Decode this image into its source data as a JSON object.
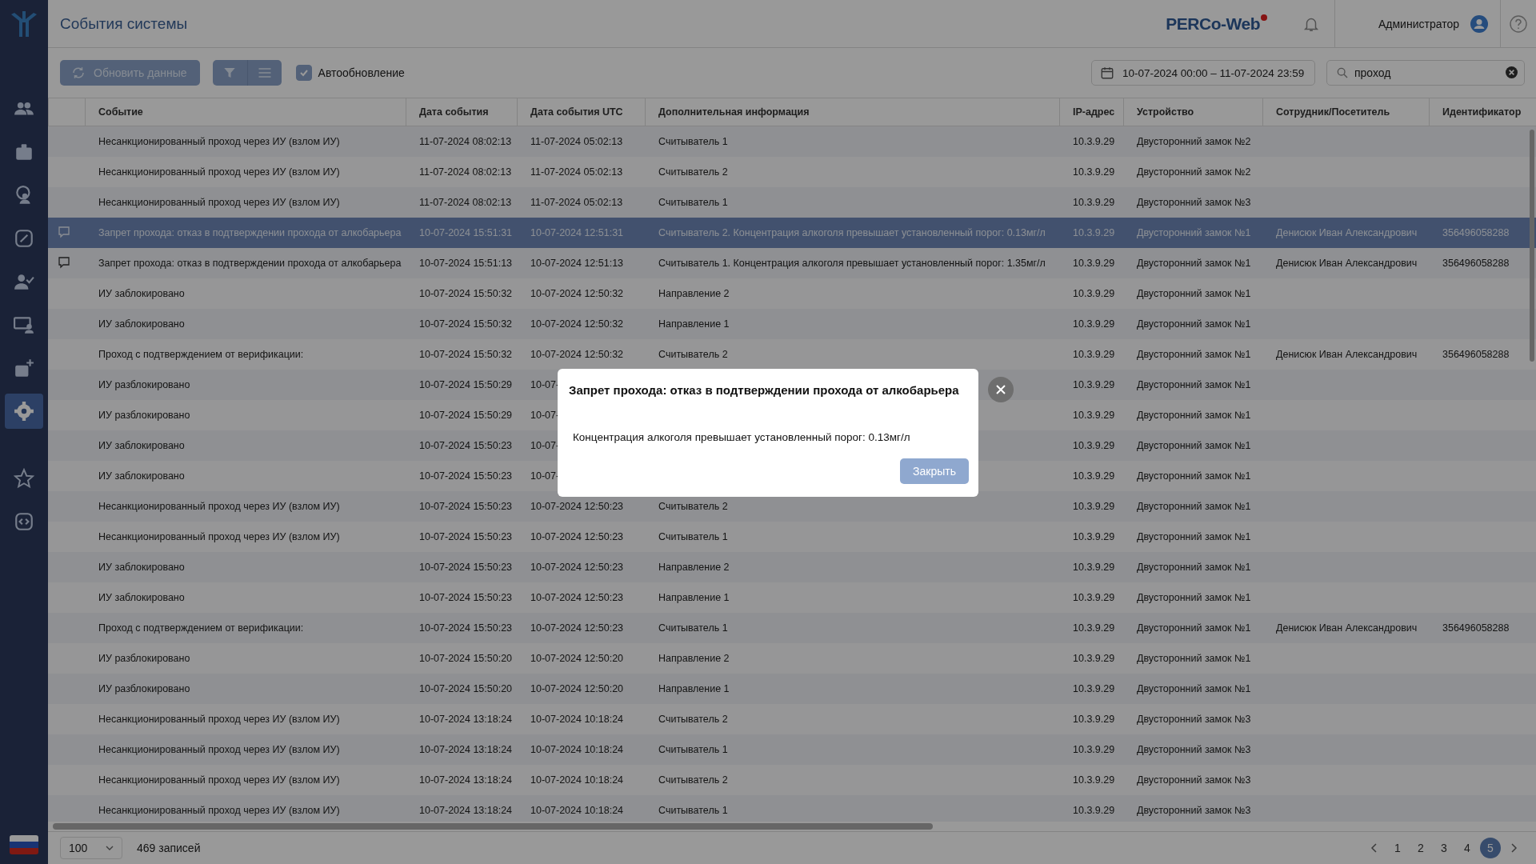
{
  "sidebar": {
    "items": [
      {
        "selected": false
      },
      {
        "selected": false
      },
      {
        "selected": false
      },
      {
        "selected": false
      },
      {
        "selected": false
      },
      {
        "selected": false
      },
      {
        "selected": false
      },
      {
        "selected": true
      },
      {
        "selected": false
      },
      {
        "selected": false
      }
    ]
  },
  "header": {
    "title": "События системы",
    "logo": "PERCo-Web",
    "user": "Администратор"
  },
  "toolbar": {
    "refresh": "Обновить данные",
    "autoupdate": {
      "label": "Автообновление",
      "checked": true
    },
    "date_range": "10-07-2024 00:00 – 11-07-2024 23:59",
    "search": {
      "value": "проход"
    }
  },
  "table": {
    "columns": [
      "Событие",
      "Дата события",
      "Дата события UTC",
      "Дополнительная информация",
      "IP-адрес",
      "Устройство",
      "Сотрудник/Посетитель",
      "Идентификатор"
    ],
    "rows": [
      {
        "selected": false,
        "comment": false,
        "cells": [
          "Несанкционированный проход через ИУ (взлом ИУ)",
          "11-07-2024 08:02:13",
          "11-07-2024 05:02:13",
          "Считыватель 1",
          "10.3.9.29",
          "Двусторонний замок №2",
          "",
          ""
        ]
      },
      {
        "selected": false,
        "comment": false,
        "cells": [
          "Несанкционированный проход через ИУ (взлом ИУ)",
          "11-07-2024 08:02:13",
          "11-07-2024 05:02:13",
          "Считыватель 2",
          "10.3.9.29",
          "Двусторонний замок №2",
          "",
          ""
        ]
      },
      {
        "selected": false,
        "comment": false,
        "cells": [
          "Несанкционированный проход через ИУ (взлом ИУ)",
          "11-07-2024 08:02:13",
          "11-07-2024 05:02:13",
          "Считыватель 1",
          "10.3.9.29",
          "Двусторонний замок №3",
          "",
          ""
        ]
      },
      {
        "selected": true,
        "comment": true,
        "cells": [
          "Запрет прохода: отказ в подтверждении прохода от алкобарьера",
          "10-07-2024 15:51:31",
          "10-07-2024 12:51:31",
          "Считыватель 2. Концентрация алкоголя превышает установленный порог: 0.13мг/л",
          "10.3.9.29",
          "Двусторонний замок №1",
          "Денисюк Иван Александрович",
          "356496058288"
        ]
      },
      {
        "selected": false,
        "comment": true,
        "cells": [
          "Запрет прохода: отказ в подтверждении прохода от алкобарьера",
          "10-07-2024 15:51:13",
          "10-07-2024 12:51:13",
          "Считыватель 1. Концентрация алкоголя превышает установленный порог: 1.35мг/л",
          "10.3.9.29",
          "Двусторонний замок №1",
          "Денисюк Иван Александрович",
          "356496058288"
        ]
      },
      {
        "selected": false,
        "comment": false,
        "cells": [
          "ИУ заблокировано",
          "10-07-2024 15:50:32",
          "10-07-2024 12:50:32",
          "Направление 2",
          "10.3.9.29",
          "Двусторонний замок №1",
          "",
          ""
        ]
      },
      {
        "selected": false,
        "comment": false,
        "cells": [
          "ИУ заблокировано",
          "10-07-2024 15:50:32",
          "10-07-2024 12:50:32",
          "Направление 1",
          "10.3.9.29",
          "Двусторонний замок №1",
          "",
          ""
        ]
      },
      {
        "selected": false,
        "comment": false,
        "cells": [
          "Проход с подтверждением от верификации:",
          "10-07-2024 15:50:32",
          "10-07-2024 12:50:32",
          "Считыватель 2",
          "10.3.9.29",
          "Двусторонний замок №1",
          "Денисюк Иван Александрович",
          "356496058288"
        ]
      },
      {
        "selected": false,
        "comment": false,
        "cells": [
          "ИУ разблокировано",
          "10-07-2024 15:50:29",
          "10-07-",
          "",
          "10.3.9.29",
          "Двусторонний замок №1",
          "",
          ""
        ]
      },
      {
        "selected": false,
        "comment": false,
        "cells": [
          "ИУ разблокировано",
          "10-07-2024 15:50:29",
          "10-07-",
          "",
          "10.3.9.29",
          "Двусторонний замок №1",
          "",
          ""
        ]
      },
      {
        "selected": false,
        "comment": false,
        "cells": [
          "ИУ заблокировано",
          "10-07-2024 15:50:23",
          "10-07-",
          "",
          "10.3.9.29",
          "Двусторонний замок №1",
          "",
          ""
        ]
      },
      {
        "selected": false,
        "comment": false,
        "cells": [
          "ИУ заблокировано",
          "10-07-2024 15:50:23",
          "10-07-",
          "",
          "10.3.9.29",
          "Двусторонний замок №1",
          "",
          ""
        ]
      },
      {
        "selected": false,
        "comment": false,
        "cells": [
          "Несанкционированный проход через ИУ (взлом ИУ)",
          "10-07-2024 15:50:23",
          "10-07-2024 12:50:23",
          "Считыватель 2",
          "10.3.9.29",
          "Двусторонний замок №1",
          "",
          ""
        ]
      },
      {
        "selected": false,
        "comment": false,
        "cells": [
          "Несанкционированный проход через ИУ (взлом ИУ)",
          "10-07-2024 15:50:23",
          "10-07-2024 12:50:23",
          "Считыватель 1",
          "10.3.9.29",
          "Двусторонний замок №1",
          "",
          ""
        ]
      },
      {
        "selected": false,
        "comment": false,
        "cells": [
          "ИУ заблокировано",
          "10-07-2024 15:50:23",
          "10-07-2024 12:50:23",
          "Направление 2",
          "10.3.9.29",
          "Двусторонний замок №1",
          "",
          ""
        ]
      },
      {
        "selected": false,
        "comment": false,
        "cells": [
          "ИУ заблокировано",
          "10-07-2024 15:50:23",
          "10-07-2024 12:50:23",
          "Направление 1",
          "10.3.9.29",
          "Двусторонний замок №1",
          "",
          ""
        ]
      },
      {
        "selected": false,
        "comment": false,
        "cells": [
          "Проход с подтверждением от верификации:",
          "10-07-2024 15:50:23",
          "10-07-2024 12:50:23",
          "Считыватель 1",
          "10.3.9.29",
          "Двусторонний замок №1",
          "Денисюк Иван Александрович",
          "356496058288"
        ]
      },
      {
        "selected": false,
        "comment": false,
        "cells": [
          "ИУ разблокировано",
          "10-07-2024 15:50:20",
          "10-07-2024 12:50:20",
          "Направление 2",
          "10.3.9.29",
          "Двусторонний замок №1",
          "",
          ""
        ]
      },
      {
        "selected": false,
        "comment": false,
        "cells": [
          "ИУ разблокировано",
          "10-07-2024 15:50:20",
          "10-07-2024 12:50:20",
          "Направление 1",
          "10.3.9.29",
          "Двусторонний замок №1",
          "",
          ""
        ]
      },
      {
        "selected": false,
        "comment": false,
        "cells": [
          "Несанкционированный проход через ИУ (взлом ИУ)",
          "10-07-2024 13:18:24",
          "10-07-2024 10:18:24",
          "Считыватель 2",
          "10.3.9.29",
          "Двусторонний замок №3",
          "",
          ""
        ]
      },
      {
        "selected": false,
        "comment": false,
        "cells": [
          "Несанкционированный проход через ИУ (взлом ИУ)",
          "10-07-2024 13:18:24",
          "10-07-2024 10:18:24",
          "Считыватель 1",
          "10.3.9.29",
          "Двусторонний замок №3",
          "",
          ""
        ]
      },
      {
        "selected": false,
        "comment": false,
        "cells": [
          "Несанкционированный проход через ИУ (взлом ИУ)",
          "10-07-2024 13:18:24",
          "10-07-2024 10:18:24",
          "Считыватель 2",
          "10.3.9.29",
          "Двусторонний замок №3",
          "",
          ""
        ]
      },
      {
        "selected": false,
        "comment": false,
        "cells": [
          "Несанкционированный проход через ИУ (взлом ИУ)",
          "10-07-2024 13:18:24",
          "10-07-2024 10:18:24",
          "Считыватель 1",
          "10.3.9.29",
          "Двусторонний замок №3",
          "",
          ""
        ]
      }
    ]
  },
  "footer": {
    "page_size": "100",
    "count": "469 записей",
    "pages": [
      {
        "label": "1",
        "selected": false
      },
      {
        "label": "2",
        "selected": false
      },
      {
        "label": "3",
        "selected": false
      },
      {
        "label": "4",
        "selected": false
      },
      {
        "label": "5",
        "selected": true
      }
    ]
  },
  "dialog": {
    "title": "Запрет прохода: отказ в подтверждении прохода от алкобарьера",
    "message": "Концентрация алкоголя превышает установленный порог: 0.13мг/л",
    "button": "Закрыть"
  }
}
